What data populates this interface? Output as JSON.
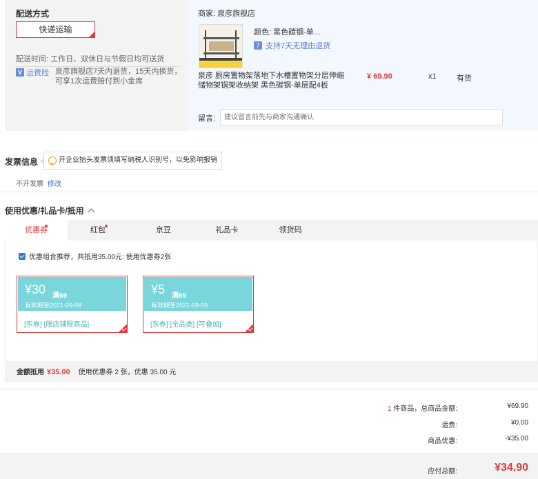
{
  "shipping": {
    "title": "配送方式",
    "method": "快递运输",
    "time_label": "配送时间:",
    "time_value": "工作日、双休日与节假日均可送货",
    "insurance_tag": "运费险",
    "insurance_text": "泉彦旗舰店7天内退货，15天内换货，可享1次运费赔付到小金库"
  },
  "seller": {
    "label": "商家:",
    "name": "泉彦旗舰店"
  },
  "product": {
    "color_label": "颜色:",
    "color_value": "黑色碳钢-单...",
    "return_icon": "7",
    "return_text": "支持7天无理由退货",
    "name": "泉彦 厨房置物架落地下水槽置物架分层伸缩储物架锅架收纳架 黑色碳钢-单层配4板",
    "price": "¥ 69.90",
    "qty": "x1",
    "stock": "有货",
    "image_icon": "kitchen-shelf-photo"
  },
  "remark": {
    "label": "留言:",
    "placeholder": "建议留言前先与商家沟通确认"
  },
  "invoice": {
    "title": "发票信息",
    "tip": "开企业抬头发票须填写纳税人识别号，以免影响报销",
    "status": "不开发票",
    "edit": "修改"
  },
  "coupons": {
    "title": "使用优惠/礼品卡/抵用",
    "tabs": [
      {
        "label": "优惠券",
        "dot": true
      },
      {
        "label": "红包",
        "dot": true
      },
      {
        "label": "京豆",
        "dot": false
      },
      {
        "label": "礼品卡",
        "dot": false
      },
      {
        "label": "领货码",
        "dot": false
      }
    ],
    "combo_text": "优惠组合推荐，共抵用35.00元: 使用优惠券2张",
    "cards": [
      {
        "amount": "¥30",
        "condition": "满69",
        "expiry": "有效期至2021-09-08",
        "tags": [
          "[东券]",
          "[限店铺限商品]"
        ]
      },
      {
        "amount": "¥5",
        "condition": "满69",
        "expiry": "有效期至2021-09-09",
        "tags": [
          "[东券]",
          "[全品类]",
          "[可叠加]"
        ]
      }
    ],
    "deduct_label": "金额抵用",
    "deduct_amount": "¥35.00",
    "deduct_detail": "使用优惠券 2 张，优惠 35.00 元"
  },
  "summary": {
    "count": "1",
    "count_suffix": "件商品，总商品金额:",
    "goods_total": "¥69.90",
    "freight_label": "运费:",
    "freight": "¥0.00",
    "discount_label": "商品优惠:",
    "discount": "-¥35.00",
    "payable_label": "应付总额:",
    "payable": "¥34.90"
  },
  "colors": {
    "accent": "#e4393c",
    "coupon_teal": "#79d6da",
    "link_blue": "#2e6bc9"
  }
}
